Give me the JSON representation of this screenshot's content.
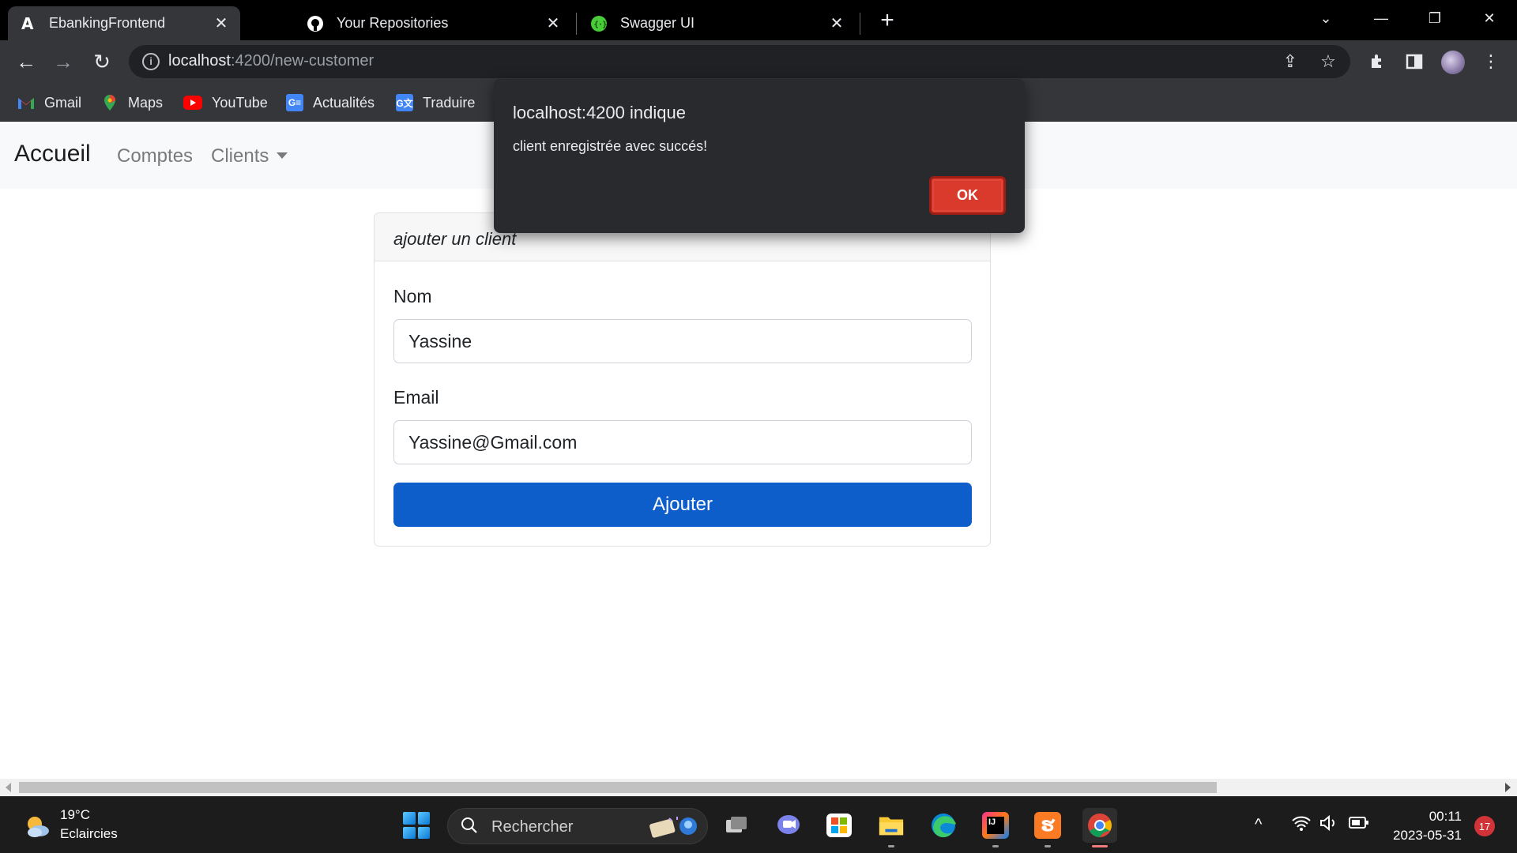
{
  "browser": {
    "tabs": [
      {
        "title": "EbankingFrontend",
        "icon": "angular-icon",
        "active": true
      },
      {
        "title": "Your Repositories",
        "icon": "github-icon",
        "active": false
      },
      {
        "title": "Swagger UI",
        "icon": "swagger-icon",
        "active": false
      }
    ],
    "url_host": "localhost",
    "url_rest": ":4200/new-customer",
    "bookmarks": [
      {
        "label": "Gmail"
      },
      {
        "label": "Maps"
      },
      {
        "label": "YouTube"
      },
      {
        "label": "Actualités"
      },
      {
        "label": "Traduire"
      }
    ]
  },
  "page": {
    "brand": "Accueil",
    "nav": {
      "comptes": "Comptes",
      "clients": "Clients"
    },
    "form": {
      "header": "ajouter un client",
      "name_label": "Nom",
      "name_value": "Yassine",
      "email_label": "Email",
      "email_value": "Yassine@Gmail.com",
      "submit_label": "Ajouter"
    }
  },
  "alert": {
    "origin": "localhost:4200 indique",
    "message": "client enregistrée avec succés!",
    "ok_label": "OK"
  },
  "taskbar": {
    "weather_temp": "19°C",
    "weather_desc": "Eclaircies",
    "search_placeholder": "Rechercher",
    "time": "00:11",
    "date": "2023-05-31",
    "notifications": "17"
  },
  "colors": {
    "primary_button": "#0d5ecb",
    "alert_ok": "#d93a2b",
    "navbar_bg": "#f8f9fa"
  }
}
